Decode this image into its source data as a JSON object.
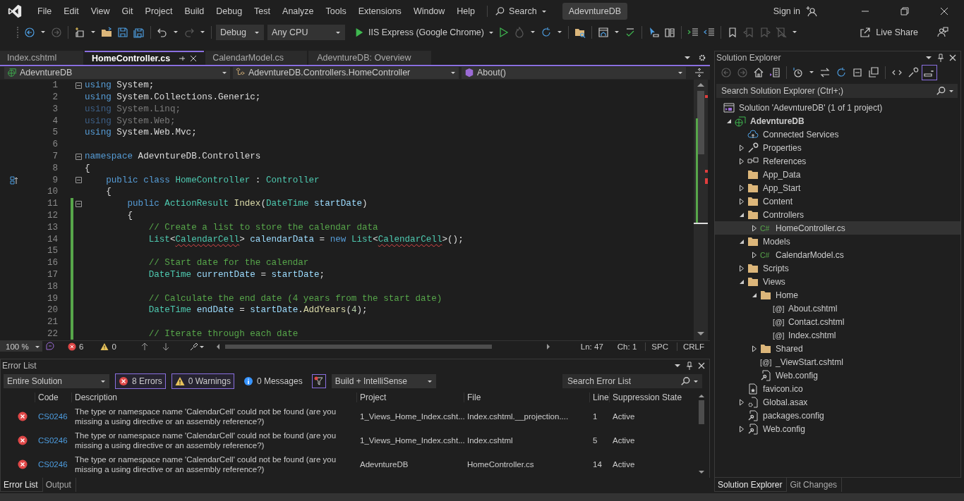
{
  "menu": {
    "items": [
      "File",
      "Edit",
      "View",
      "Git",
      "Project",
      "Build",
      "Debug",
      "Test",
      "Analyze",
      "Tools",
      "Extensions",
      "Window",
      "Help"
    ],
    "search": "Search",
    "solution_name": "AdevntureDB",
    "sign_in": "Sign in"
  },
  "toolbar": {
    "configuration": "Debug",
    "platform": "Any CPU",
    "run_target": "IIS Express (Google Chrome)",
    "live_share": "Live Share"
  },
  "document_tabs": [
    {
      "label": "Index.cshtml",
      "selected": false
    },
    {
      "label": "HomeController.cs",
      "selected": true
    },
    {
      "label": "CalendarModel.cs",
      "selected": false
    },
    {
      "label": "AdevntureDB: Overview",
      "selected": false
    }
  ],
  "navigation_bar": {
    "project": "AdevntureDB",
    "type": "AdevntureDB.Controllers.HomeController",
    "member": "About()"
  },
  "editor": {
    "lines": [
      {
        "n": "1",
        "fold": true,
        "changed": false,
        "glyph": false,
        "tokens": [
          {
            "kind": "kw",
            "t": "using"
          },
          {
            "kind": "plain",
            "t": " System;"
          }
        ]
      },
      {
        "n": "2",
        "fold": false,
        "changed": false,
        "glyph": false,
        "tokens": [
          {
            "kind": "kw",
            "t": "using"
          },
          {
            "kind": "plain",
            "t": " System.Collections.Generic;"
          }
        ]
      },
      {
        "n": "3",
        "fold": false,
        "changed": false,
        "glyph": false,
        "tokens": [
          {
            "kind": "unusedkw",
            "t": "using"
          },
          {
            "kind": "unused",
            "t": " System.Linq;"
          }
        ]
      },
      {
        "n": "4",
        "fold": false,
        "changed": false,
        "glyph": false,
        "tokens": [
          {
            "kind": "unusedkw",
            "t": "using"
          },
          {
            "kind": "unused",
            "t": " System.Web;"
          }
        ]
      },
      {
        "n": "5",
        "fold": false,
        "changed": false,
        "glyph": false,
        "tokens": [
          {
            "kind": "kw",
            "t": "using"
          },
          {
            "kind": "plain",
            "t": " System.Web.Mvc;"
          }
        ]
      },
      {
        "n": "6",
        "fold": false,
        "changed": false,
        "glyph": false
      },
      {
        "n": "7",
        "fold": true,
        "changed": false,
        "glyph": false,
        "tokens": [
          {
            "kind": "kw",
            "t": "namespace"
          },
          {
            "kind": "plain",
            "t": " AdevntureDB.Controllers"
          }
        ]
      },
      {
        "n": "8",
        "fold": false,
        "changed": false,
        "glyph": false,
        "tokens": [
          {
            "kind": "plain",
            "t": "{"
          }
        ]
      },
      {
        "n": "9",
        "fold": true,
        "changed": false,
        "glyph": true,
        "tokens": [
          {
            "kind": "kw",
            "t": "    public class"
          },
          {
            "kind": "type",
            "t": " HomeController"
          },
          {
            "kind": "plain",
            "t": " : "
          },
          {
            "kind": "type",
            "t": "Controller"
          }
        ]
      },
      {
        "n": "10",
        "fold": false,
        "changed": false,
        "glyph": false,
        "tokens": [
          {
            "kind": "plain",
            "t": "    {"
          }
        ]
      },
      {
        "n": "11",
        "fold": true,
        "changed": true,
        "glyph": false,
        "tokens": [
          {
            "kind": "kw",
            "t": "        public"
          },
          {
            "kind": "type",
            "t": " ActionResult"
          },
          {
            "kind": "method",
            "t": " Index"
          },
          {
            "kind": "plain",
            "t": "("
          },
          {
            "kind": "type",
            "t": "DateTime"
          },
          {
            "kind": "param",
            "t": " startDate"
          },
          {
            "kind": "plain",
            "t": ")"
          }
        ]
      },
      {
        "n": "12",
        "fold": false,
        "changed": true,
        "glyph": false,
        "tokens": [
          {
            "kind": "plain",
            "t": "        {"
          }
        ]
      },
      {
        "n": "13",
        "fold": false,
        "changed": true,
        "glyph": false,
        "tokens": [
          {
            "kind": "comment",
            "t": "            // Create a list to store the calendar data"
          }
        ]
      },
      {
        "n": "14",
        "fold": false,
        "changed": true,
        "glyph": false,
        "tokens": [
          {
            "kind": "type",
            "t": "            List"
          },
          {
            "kind": "plain",
            "t": "<"
          },
          {
            "kind": "err",
            "t": "CalendarCell"
          },
          {
            "kind": "plain",
            "t": "> "
          },
          {
            "kind": "param",
            "t": "calendarData"
          },
          {
            "kind": "plain",
            "t": " = "
          },
          {
            "kind": "kw",
            "t": "new"
          },
          {
            "kind": "type",
            "t": " List"
          },
          {
            "kind": "plain",
            "t": "<"
          },
          {
            "kind": "err",
            "t": "CalendarCell"
          },
          {
            "kind": "plain",
            "t": ">();"
          }
        ]
      },
      {
        "n": "15",
        "fold": false,
        "changed": true,
        "glyph": false
      },
      {
        "n": "16",
        "fold": false,
        "changed": true,
        "glyph": false,
        "tokens": [
          {
            "kind": "comment",
            "t": "            // Start date for the calendar"
          }
        ]
      },
      {
        "n": "17",
        "fold": false,
        "changed": true,
        "glyph": false,
        "tokens": [
          {
            "kind": "type",
            "t": "            DateTime"
          },
          {
            "kind": "param",
            "t": " currentDate"
          },
          {
            "kind": "plain",
            "t": " = "
          },
          {
            "kind": "param",
            "t": "startDate"
          },
          {
            "kind": "plain",
            "t": ";"
          }
        ]
      },
      {
        "n": "18",
        "fold": false,
        "changed": true,
        "glyph": false
      },
      {
        "n": "19",
        "fold": false,
        "changed": true,
        "glyph": false,
        "tokens": [
          {
            "kind": "comment",
            "t": "            // Calculate the end date (4 years from the start date)"
          }
        ]
      },
      {
        "n": "20",
        "fold": false,
        "changed": true,
        "glyph": false,
        "tokens": [
          {
            "kind": "type",
            "t": "            DateTime"
          },
          {
            "kind": "param",
            "t": " endDate"
          },
          {
            "kind": "plain",
            "t": " = "
          },
          {
            "kind": "param",
            "t": "startDate"
          },
          {
            "kind": "plain",
            "t": "."
          },
          {
            "kind": "method",
            "t": "AddYears"
          },
          {
            "kind": "plain",
            "t": "("
          },
          {
            "kind": "number",
            "t": "4"
          },
          {
            "kind": "plain",
            "t": ");"
          }
        ]
      },
      {
        "n": "21",
        "fold": false,
        "changed": true,
        "glyph": false
      },
      {
        "n": "22",
        "fold": false,
        "changed": true,
        "glyph": false,
        "tokens": [
          {
            "kind": "comment",
            "t": "            // Iterate through each date"
          }
        ]
      }
    ]
  },
  "editor_status": {
    "zoom": "100 %",
    "errors": "6",
    "warnings": "0",
    "line": "Ln: 47",
    "column": "Ch: 1",
    "whitespace": "SPC",
    "line_ending": "CRLF"
  },
  "error_list": {
    "title": "Error List",
    "scope": "Entire Solution",
    "filters": [
      {
        "kind": "error",
        "label": "8 Errors",
        "on": true
      },
      {
        "kind": "warning",
        "label": "0 Warnings",
        "on": true
      },
      {
        "kind": "message",
        "label": "0 Messages",
        "on": false
      }
    ],
    "source": "Build + IntelliSense",
    "search_placeholder": "Search Error List",
    "columns": [
      "Code",
      "Description",
      "Project",
      "File",
      "Line",
      "Suppression State"
    ],
    "rows": [
      {
        "code": "CS0246",
        "description": "The type or namespace name 'CalendarCell' could not be found (are you missing a using directive or an assembly reference?)",
        "project": "1_Views_Home_Index.csht...",
        "file": "Index.cshtml.__projection....",
        "line": "1",
        "state": "Active"
      },
      {
        "code": "CS0246",
        "description": "The type or namespace name 'CalendarCell' could not be found (are you missing a using directive or an assembly reference?)",
        "project": "1_Views_Home_Index.csht...",
        "file": "Index.cshtml",
        "line": "5",
        "state": "Active"
      },
      {
        "code": "CS0246",
        "description": "The type or namespace name 'CalendarCell' could not be found (are you missing a using directive or an assembly reference?)",
        "project": "AdevntureDB",
        "file": "HomeController.cs",
        "line": "14",
        "state": "Active"
      }
    ]
  },
  "bottom_tabs": [
    {
      "label": "Error List",
      "selected": true
    },
    {
      "label": "Output",
      "selected": false
    }
  ],
  "solution_explorer": {
    "title": "Solution Explorer",
    "search_placeholder": "Search Solution Explorer (Ctrl+;)",
    "tree": [
      {
        "kind": "solution",
        "label": "Solution 'AdevntureDB' (1 of 1 project)",
        "selected": false,
        "children": [
          {
            "kind": "project",
            "label": "AdevntureDB",
            "expanded": true,
            "selected": false,
            "children": [
              {
                "kind": "service",
                "label": "Connected Services",
                "selected": false
              },
              {
                "kind": "properties",
                "label": "Properties",
                "expanded": false,
                "selected": false
              },
              {
                "kind": "references",
                "label": "References",
                "expanded": false,
                "selected": false
              },
              {
                "kind": "folder",
                "label": "App_Data",
                "selected": false
              },
              {
                "kind": "folder",
                "label": "App_Start",
                "expanded": false,
                "selected": false
              },
              {
                "kind": "folder",
                "label": "Content",
                "expanded": false,
                "selected": false
              },
              {
                "kind": "folder",
                "label": "Controllers",
                "expanded": true,
                "selected": false,
                "children": [
                  {
                    "kind": "csharp",
                    "badge": "C#",
                    "label": "HomeController.cs",
                    "expanded": false,
                    "selected": true
                  }
                ]
              },
              {
                "kind": "folder",
                "label": "Models",
                "expanded": true,
                "selected": false,
                "children": [
                  {
                    "kind": "csharp",
                    "badge": "C#",
                    "label": "CalendarModel.cs",
                    "expanded": false,
                    "selected": false
                  }
                ]
              },
              {
                "kind": "folder",
                "label": "Scripts",
                "expanded": false,
                "selected": false
              },
              {
                "kind": "folder",
                "label": "Views",
                "expanded": true,
                "selected": false,
                "children": [
                  {
                    "kind": "folder",
                    "label": "Home",
                    "expanded": true,
                    "selected": false,
                    "children": [
                      {
                        "kind": "razor",
                        "badge": "[@]",
                        "label": "About.cshtml",
                        "selected": false
                      },
                      {
                        "kind": "razor",
                        "badge": "[@]",
                        "label": "Contact.cshtml",
                        "selected": false
                      },
                      {
                        "kind": "razor",
                        "badge": "[@]",
                        "label": "Index.cshtml",
                        "selected": false
                      }
                    ]
                  },
                  {
                    "kind": "folder",
                    "label": "Shared",
                    "expanded": false,
                    "selected": false
                  },
                  {
                    "kind": "razor",
                    "badge": "[@]",
                    "label": "_ViewStart.cshtml",
                    "selected": false
                  },
                  {
                    "kind": "config",
                    "label": "Web.config",
                    "selected": false
                  }
                ]
              },
              {
                "kind": "icon",
                "label": "favicon.ico",
                "selected": false
              },
              {
                "kind": "asax",
                "label": "Global.asax",
                "expanded": false,
                "selected": false
              },
              {
                "kind": "config",
                "label": "packages.config",
                "selected": false
              },
              {
                "kind": "config",
                "label": "Web.config",
                "expanded": false,
                "selected": false
              }
            ]
          }
        ]
      }
    ],
    "tabs": [
      {
        "label": "Solution Explorer",
        "selected": true
      },
      {
        "label": "Git Changes",
        "selected": false
      }
    ]
  }
}
